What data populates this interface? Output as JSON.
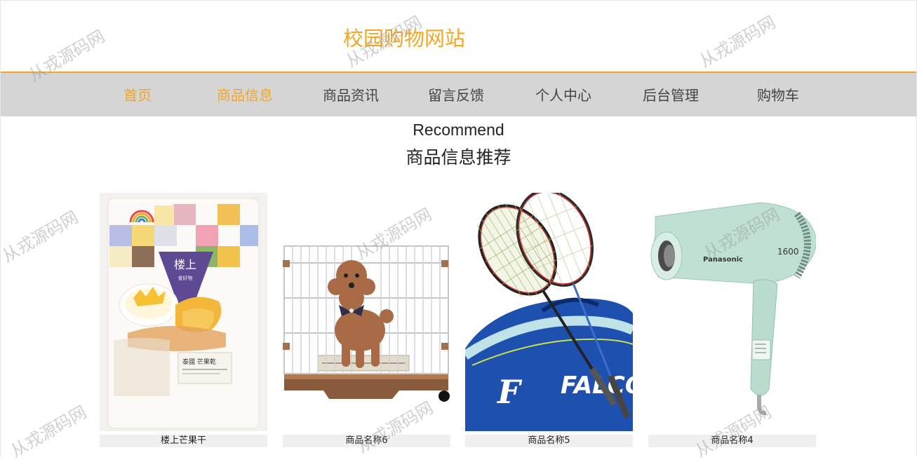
{
  "site": {
    "title": "校园购物网站"
  },
  "nav": {
    "items": [
      {
        "label": "首页"
      },
      {
        "label": "商品信息"
      },
      {
        "label": "商品资讯"
      },
      {
        "label": "留言反馈"
      },
      {
        "label": "个人中心"
      },
      {
        "label": "后台管理"
      },
      {
        "label": "购物车"
      }
    ],
    "active_color": "#f5a623"
  },
  "recommend": {
    "title_en": "Recommend",
    "title_cn": "商品信息推荐"
  },
  "products": [
    {
      "name": "楼上芒果干",
      "image_icon": "mango-snack-package-image",
      "package_text": "楼上",
      "package_sub": "食好物",
      "package_label": "泰國 芒果乾"
    },
    {
      "name": "商品名称6",
      "image_icon": "dog-in-cage-image"
    },
    {
      "name": "商品名称5",
      "image_icon": "badminton-rackets-image",
      "bag_text": "FALCO"
    },
    {
      "name": "商品名称4",
      "image_icon": "hair-dryer-image",
      "brand_text": "Panasonic",
      "model_text": "1600"
    }
  ],
  "watermark": {
    "text": "从戎源码网"
  }
}
